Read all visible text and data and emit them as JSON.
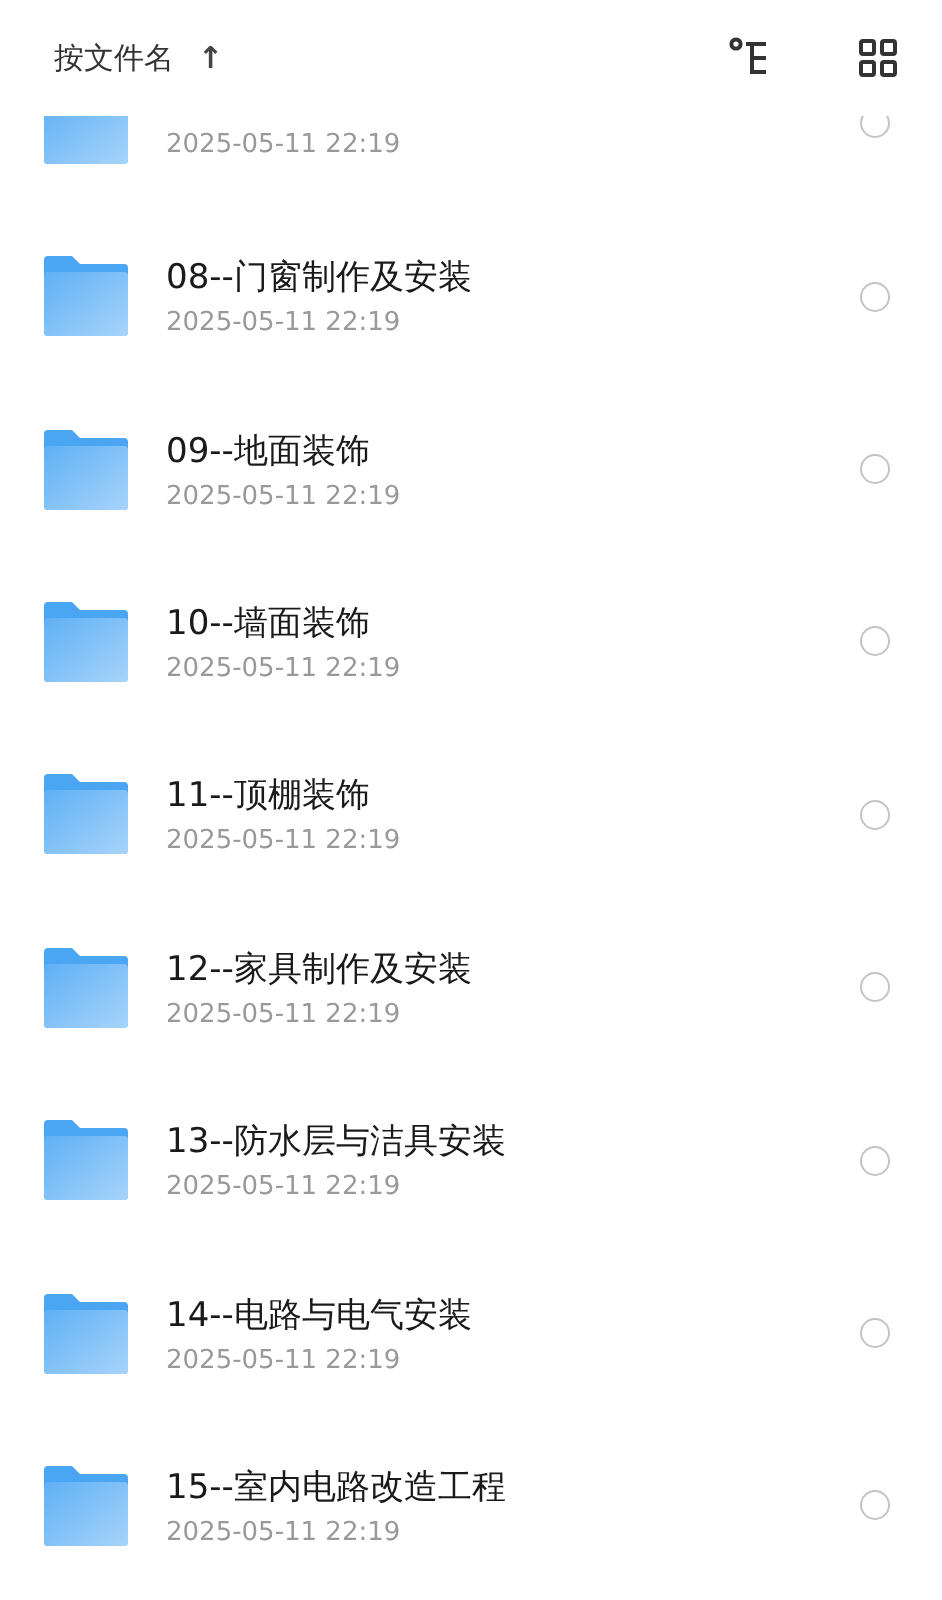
{
  "header": {
    "sort_label": "按文件名",
    "sort_arrow": "↑"
  },
  "files": [
    {
      "kind": "partial",
      "date": "2025-05-11 22:19",
      "selected": false
    },
    {
      "kind": "folder",
      "name": "08--门窗制作及安装",
      "date": "2025-05-11 22:19",
      "selected": false
    },
    {
      "kind": "folder",
      "name": "09--地面装饰",
      "date": "2025-05-11 22:19",
      "selected": false
    },
    {
      "kind": "folder",
      "name": "10--墙面装饰",
      "date": "2025-05-11 22:19",
      "selected": false
    },
    {
      "kind": "folder",
      "name": "11--顶棚装饰",
      "date": "2025-05-11 22:19",
      "selected": false
    },
    {
      "kind": "folder",
      "name": "12--家具制作及安装",
      "date": "2025-05-11 22:19",
      "selected": false
    },
    {
      "kind": "folder",
      "name": "13--防水层与洁具安装",
      "date": "2025-05-11 22:19",
      "selected": false
    },
    {
      "kind": "folder",
      "name": "14--电路与电气安装",
      "date": "2025-05-11 22:19",
      "selected": false
    },
    {
      "kind": "folder",
      "name": "15--室内电路改造工程",
      "date": "2025-05-11 22:19",
      "selected": false
    }
  ]
}
